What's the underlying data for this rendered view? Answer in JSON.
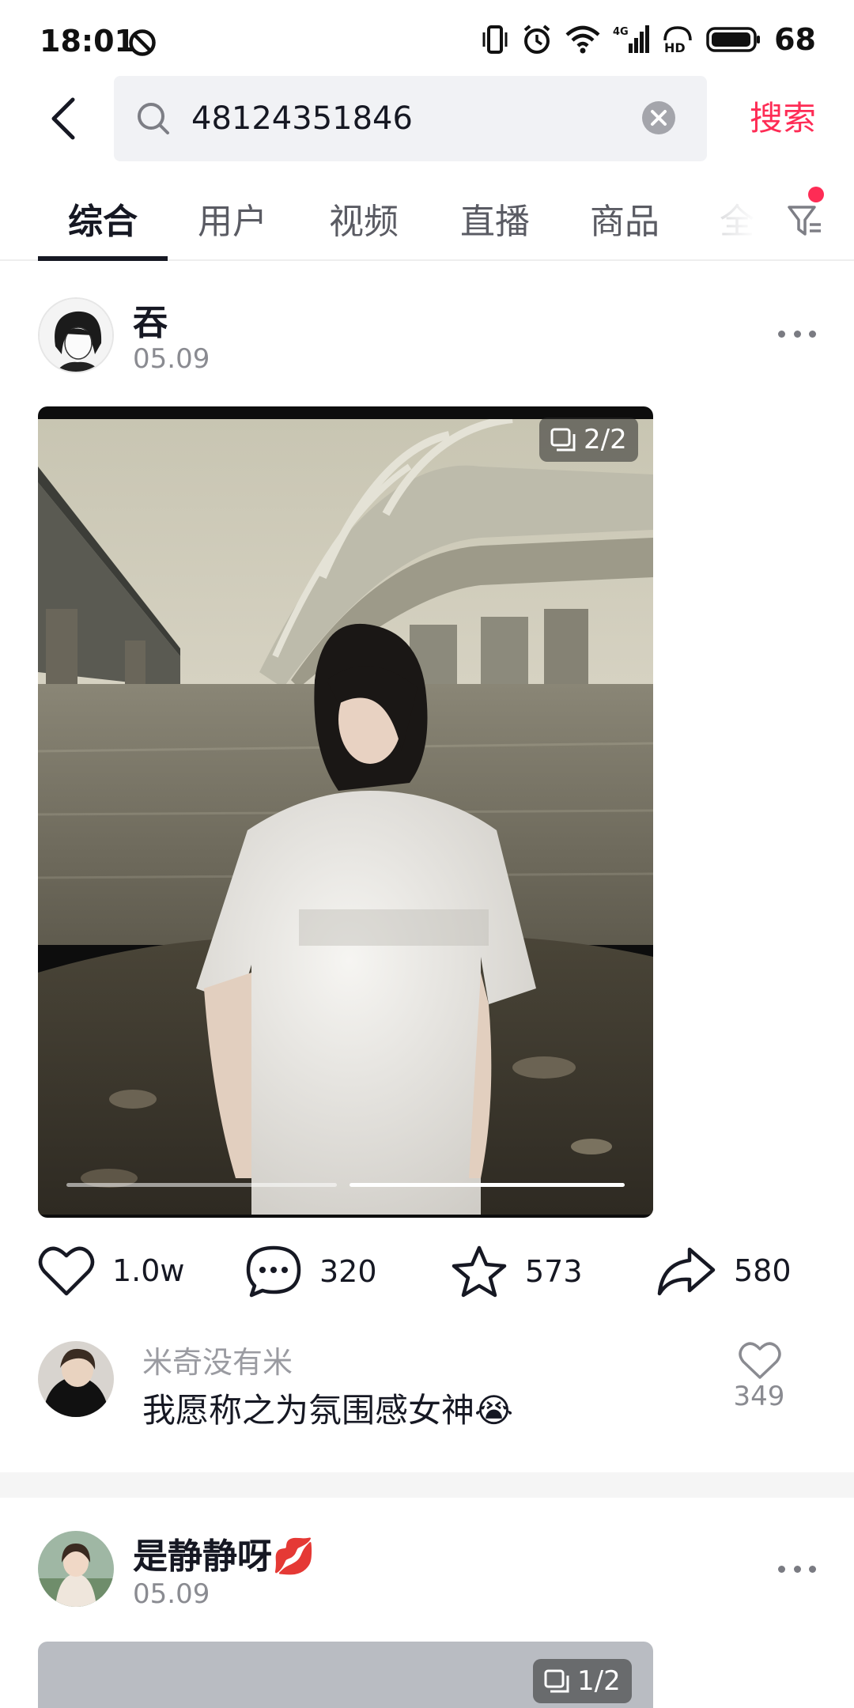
{
  "status_bar": {
    "time": "18:01",
    "battery": "68",
    "network": "4G",
    "hd_label": "HD"
  },
  "search": {
    "query": "48124351846",
    "submit_label": "搜索",
    "accent": "#fe2c55"
  },
  "tabs": [
    "综合",
    "用户",
    "视频",
    "直播",
    "商品",
    "全"
  ],
  "posts": [
    {
      "author": "吞",
      "date": "05.09",
      "page_indicator": "2/2",
      "current_page": 2,
      "total_pages": 2,
      "actions": {
        "likes": "1.0w",
        "comments": "320",
        "favorites": "573",
        "shares": "580"
      },
      "top_comment": {
        "user": "米奇没有米",
        "text": "我愿称之为氛围感女神",
        "emoji": "😭",
        "likes": "349"
      }
    },
    {
      "author": "是静静呀",
      "author_emoji": "💋",
      "date": "05.09",
      "page_indicator": "1/2"
    }
  ]
}
